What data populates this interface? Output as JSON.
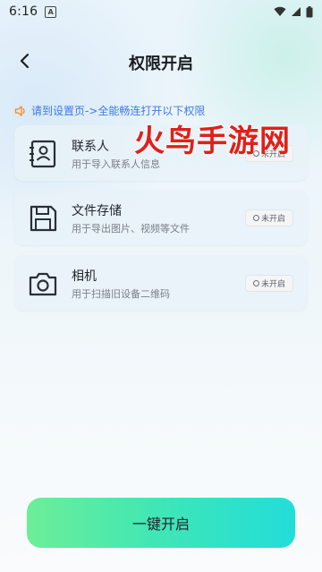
{
  "status_bar": {
    "time": "6:16",
    "notification_icon": "A",
    "icons": [
      "wifi-icon",
      "signal-icon",
      "battery-icon"
    ]
  },
  "header": {
    "back_icon": "chevron-left-icon",
    "title": "权限开启"
  },
  "notice": {
    "icon": "speaker-icon",
    "text": "请到设置页->全能畅连打开以下权限",
    "color": "#3d7be5"
  },
  "permissions": [
    {
      "icon": "contacts-icon",
      "title": "联系人",
      "description": "用于导入联系人信息",
      "status": "未开启"
    },
    {
      "icon": "storage-icon",
      "title": "文件存储",
      "description": "用于导出图片、视频等文件",
      "status": "未开启"
    },
    {
      "icon": "camera-icon",
      "title": "相机",
      "description": "用于扫描旧设备二维码",
      "status": "未开启"
    }
  ],
  "watermark": {
    "text": "火鸟手游网",
    "color": "#e0201a"
  },
  "primary_button": {
    "label": "一键开启",
    "gradient": [
      "#6dee97",
      "#22ddd9"
    ]
  }
}
